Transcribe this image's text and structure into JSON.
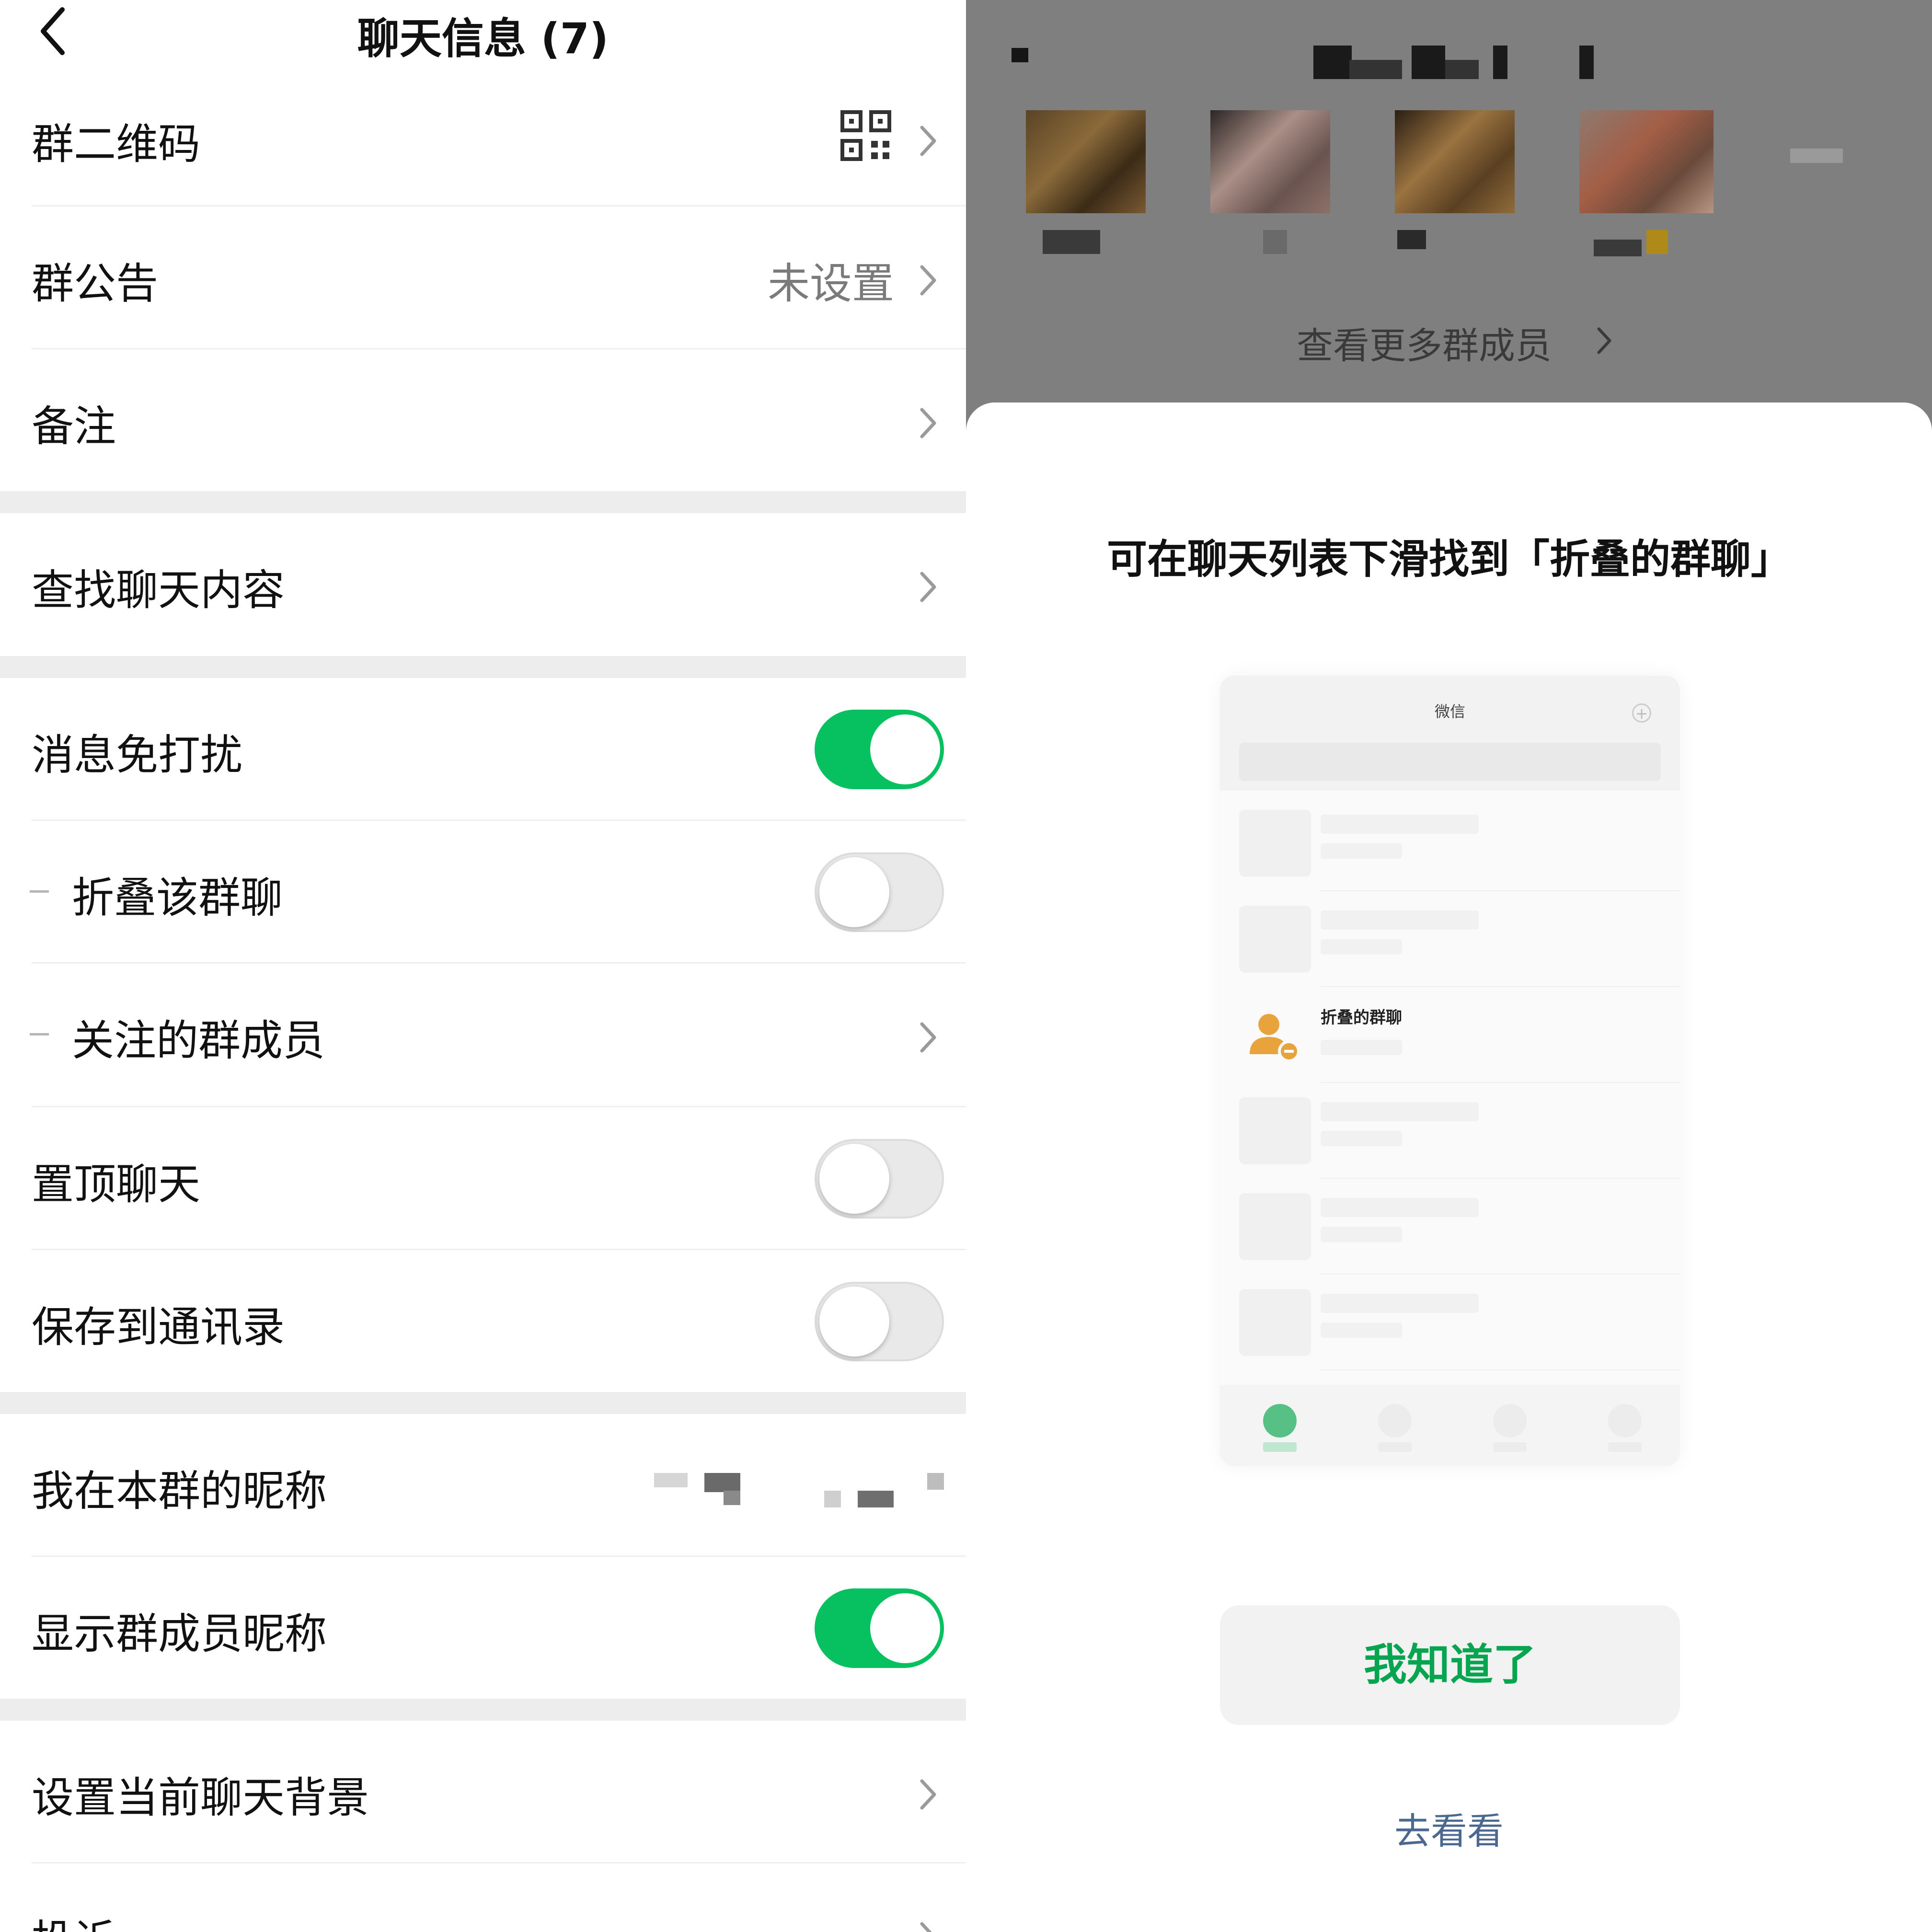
{
  "header": {
    "title": "聊天信息 (7)"
  },
  "settings": {
    "qr": "群二维码",
    "announcement": {
      "label": "群公告",
      "value": "未设置"
    },
    "remark": "备注",
    "search": "查找聊天内容",
    "mute": {
      "label": "消息免打扰",
      "on": true
    },
    "fold": {
      "label": "折叠该群聊",
      "on": false
    },
    "followed": "关注的群成员",
    "pin": {
      "label": "置顶聊天",
      "on": false
    },
    "save_contacts": {
      "label": "保存到通讯录",
      "on": false
    },
    "my_nickname": "我在本群的昵称",
    "show_nicknames": {
      "label": "显示群成员昵称",
      "on": true
    },
    "background": "设置当前聊天背景",
    "complain": "投诉"
  },
  "members": {
    "more_label": "查看更多群成员"
  },
  "dialog": {
    "title": "可在聊天列表下滑找到「折叠的群聊」",
    "mock_app_title": "微信",
    "mock_folded_label": "折叠的群聊",
    "confirm_label": "我知道了",
    "secondary_label": "去看看"
  },
  "colors": {
    "accent": "#07c160",
    "link": "#4a6890"
  }
}
